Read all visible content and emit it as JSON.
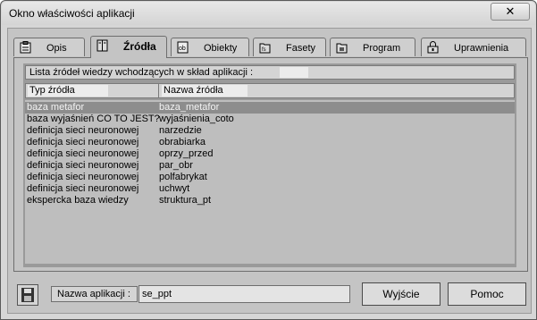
{
  "window": {
    "title": "Okno właściwości aplikacji",
    "close_glyph": "✕"
  },
  "tabs": [
    {
      "label": "Opis",
      "icon": "clipboard-icon"
    },
    {
      "label": "Źródła",
      "icon": "book-icon",
      "active": true
    },
    {
      "label": "Obiekty",
      "icon": "object-box-icon"
    },
    {
      "label": "Fasety",
      "icon": "faceted-folder-icon"
    },
    {
      "label": "Program",
      "icon": "program-folder-icon"
    },
    {
      "label": "Uprawnienia",
      "icon": "lock-icon"
    }
  ],
  "sources": {
    "caption": "Lista źródeł wiedzy wchodzących w skład aplikacji :",
    "columns": [
      "Typ źródła",
      "Nazwa źródła"
    ],
    "rows": [
      {
        "type": "baza metafor",
        "name": "baza_metafor",
        "selected": true
      },
      {
        "type": "baza wyjaśnień CO TO JEST?",
        "name": "wyjaśnienia_coto"
      },
      {
        "type": "definicja sieci neuronowej",
        "name": "narzedzie"
      },
      {
        "type": "definicja sieci neuronowej",
        "name": "obrabiarka"
      },
      {
        "type": "definicja sieci neuronowej",
        "name": "oprzy_przed"
      },
      {
        "type": "definicja sieci neuronowej",
        "name": "par_obr"
      },
      {
        "type": "definicja sieci neuronowej",
        "name": "polfabrykat"
      },
      {
        "type": "definicja sieci neuronowej",
        "name": "uchwyt"
      },
      {
        "type": "ekspercka baza wiedzy",
        "name": "struktura_pt"
      }
    ]
  },
  "footer": {
    "save_icon": "floppy-disk-icon",
    "name_label": "Nazwa aplikacji :",
    "name_value": "se_ppt",
    "exit_label": "Wyjście",
    "help_label": "Pomoc"
  },
  "colors": {
    "window_bg": "#d6d6d6",
    "panel_bg": "#c4c4c4",
    "selection": "#8d8d8d"
  }
}
